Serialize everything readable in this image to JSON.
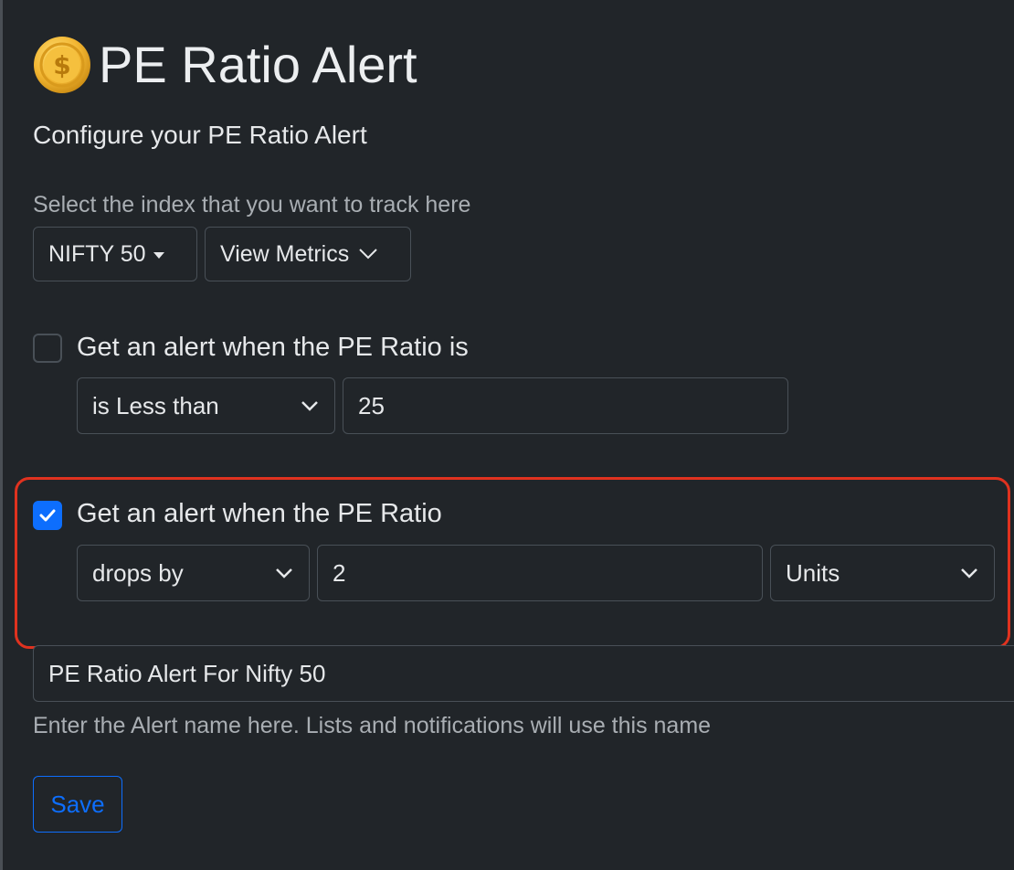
{
  "header": {
    "title": "PE Ratio Alert",
    "subtitle": "Configure your PE Ratio Alert",
    "icon": "coin-dollar-icon"
  },
  "index_selector": {
    "helper_text": "Select the index that you want to track here",
    "index_label": "NIFTY 50",
    "metrics_label": "View Metrics"
  },
  "alert_threshold": {
    "checked": false,
    "label": "Get an alert when the PE Ratio is",
    "condition": "is Less than",
    "value": "25"
  },
  "alert_change": {
    "checked": true,
    "label": "Get an alert when the PE Ratio",
    "direction": "drops by",
    "amount": "2",
    "unit": "Units"
  },
  "alert_name": {
    "value": "PE Ratio Alert For Nifty 50",
    "helper_text": "Enter the Alert name here. Lists and notifications will use this name"
  },
  "actions": {
    "save_label": "Save"
  },
  "colors": {
    "background": "#212529",
    "accent": "#0d6efd",
    "highlight": "#e0321f",
    "border": "#495057"
  }
}
